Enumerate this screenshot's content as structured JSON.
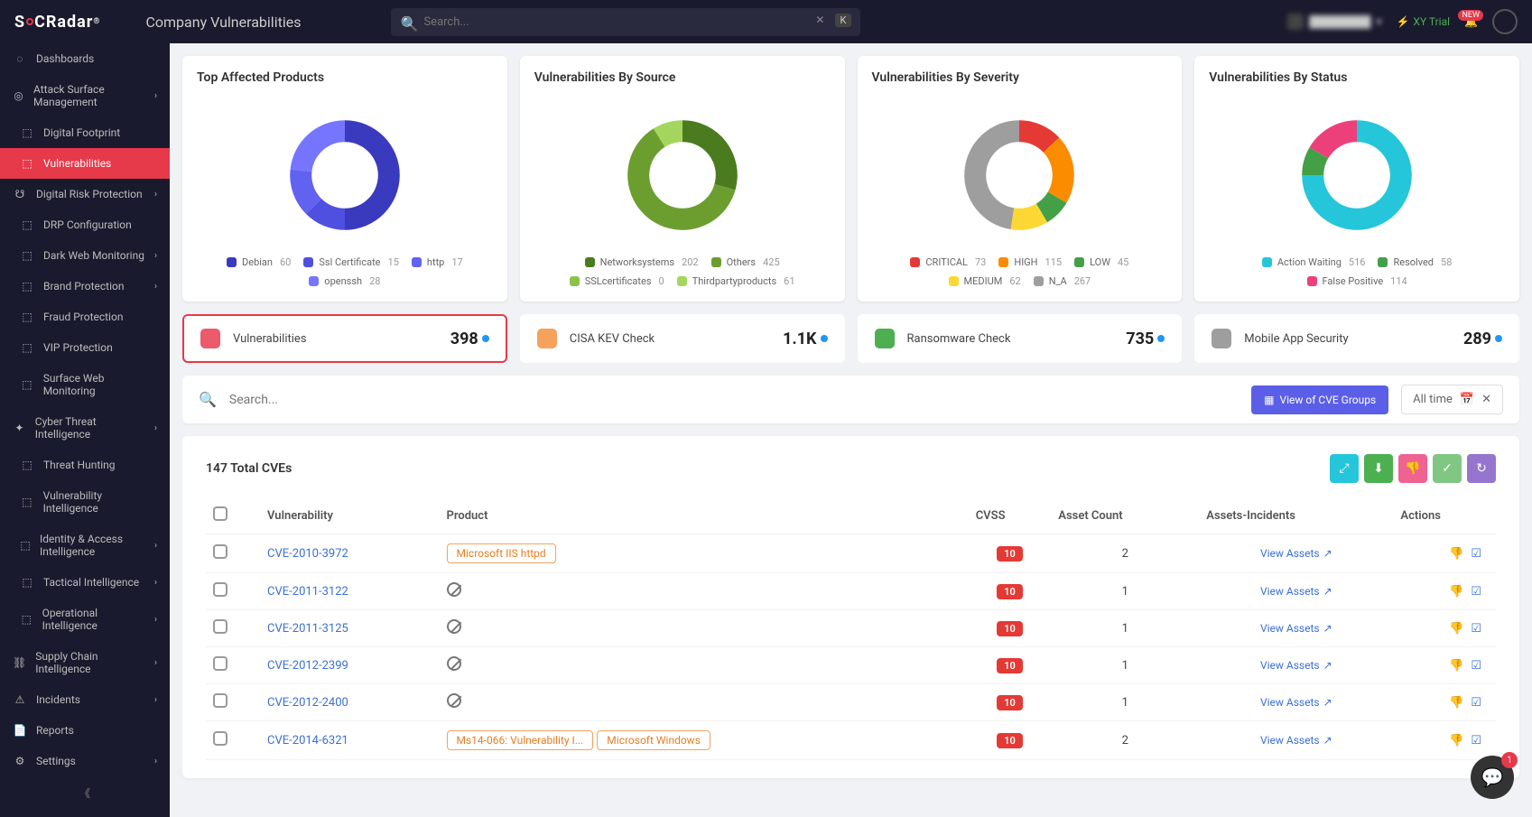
{
  "header": {
    "logo_parts": [
      "S",
      "C",
      "Radar"
    ],
    "page_title": "Company Vulnerabilities",
    "search_placeholder": "Search...",
    "kbd_key": "K",
    "trial_text": "XY Trial",
    "bell_badge_text": "NEW"
  },
  "sidebar": {
    "items": [
      {
        "icon": "◌",
        "label": "Dashboards",
        "chev": false
      },
      {
        "icon": "◎",
        "label": "Attack Surface Management",
        "chev": true
      },
      {
        "icon": "⬚",
        "label": "Digital Footprint",
        "chev": false,
        "indent": true
      },
      {
        "icon": "⬚",
        "label": "Vulnerabilities",
        "chev": false,
        "indent": true,
        "active": true
      },
      {
        "icon": "☋",
        "label": "Digital Risk Protection",
        "chev": true
      },
      {
        "icon": "⬚",
        "label": "DRP Configuration",
        "chev": false,
        "indent": true
      },
      {
        "icon": "⬚",
        "label": "Dark Web Monitoring",
        "chev": true,
        "indent": true
      },
      {
        "icon": "⬚",
        "label": "Brand Protection",
        "chev": true,
        "indent": true
      },
      {
        "icon": "⬚",
        "label": "Fraud Protection",
        "chev": false,
        "indent": true
      },
      {
        "icon": "⬚",
        "label": "VIP Protection",
        "chev": false,
        "indent": true
      },
      {
        "icon": "⬚",
        "label": "Surface Web Monitoring",
        "chev": false,
        "indent": true
      },
      {
        "icon": "✦",
        "label": "Cyber Threat Intelligence",
        "chev": true
      },
      {
        "icon": "⬚",
        "label": "Threat Hunting",
        "chev": false,
        "indent": true
      },
      {
        "icon": "⬚",
        "label": "Vulnerability Intelligence",
        "chev": false,
        "indent": true
      },
      {
        "icon": "⬚",
        "label": "Identity & Access Intelligence",
        "chev": true,
        "indent": true
      },
      {
        "icon": "⬚",
        "label": "Tactical Intelligence",
        "chev": true,
        "indent": true
      },
      {
        "icon": "⬚",
        "label": "Operational Intelligence",
        "chev": true,
        "indent": true
      },
      {
        "icon": "⛓",
        "label": "Supply Chain Intelligence",
        "chev": true
      },
      {
        "icon": "⚠",
        "label": "Incidents",
        "chev": true
      },
      {
        "icon": "📄",
        "label": "Reports",
        "chev": false
      },
      {
        "icon": "⚙",
        "label": "Settings",
        "chev": true
      }
    ]
  },
  "chart_data": [
    {
      "title": "Top Affected Products",
      "type": "pie",
      "series": [
        {
          "name": "Debian",
          "value": 60,
          "color": "#3a3abf"
        },
        {
          "name": "Ssl Certificate",
          "value": 15,
          "color": "#5050e0"
        },
        {
          "name": "http",
          "value": 17,
          "color": "#6262f0"
        },
        {
          "name": "openssh",
          "value": 28,
          "color": "#7575ff"
        }
      ]
    },
    {
      "title": "Vulnerabilities By Source",
      "type": "pie",
      "series": [
        {
          "name": "Networksystems",
          "value": 202,
          "color": "#4a7c1f"
        },
        {
          "name": "Others",
          "value": 425,
          "color": "#6b9e2f"
        },
        {
          "name": "SSLcertificates",
          "value": 0,
          "color": "#8bc34a"
        },
        {
          "name": "Thirdpartyproducts",
          "value": 61,
          "color": "#a4d65e"
        }
      ]
    },
    {
      "title": "Vulnerabilities By Severity",
      "type": "pie",
      "series": [
        {
          "name": "CRITICAL",
          "value": 73,
          "color": "#e53935"
        },
        {
          "name": "HIGH",
          "value": 115,
          "color": "#fb8c00"
        },
        {
          "name": "LOW",
          "value": 45,
          "color": "#43a047"
        },
        {
          "name": "MEDIUM",
          "value": 62,
          "color": "#fdd835"
        },
        {
          "name": "N_A",
          "value": 267,
          "color": "#9e9e9e"
        }
      ]
    },
    {
      "title": "Vulnerabilities By Status",
      "type": "pie",
      "series": [
        {
          "name": "Action Waiting",
          "value": 516,
          "color": "#26c6da"
        },
        {
          "name": "Resolved",
          "value": 58,
          "color": "#43a047"
        },
        {
          "name": "False Positive",
          "value": 114,
          "color": "#ec407a"
        }
      ]
    }
  ],
  "stats": [
    {
      "label": "Vulnerabilities",
      "value": "398",
      "color": "#ec5a6b",
      "active": true
    },
    {
      "label": "CISA KEV Check",
      "value": "1.1K",
      "color": "#f5a25d"
    },
    {
      "label": "Ransomware Check",
      "value": "735",
      "color": "#4caf50"
    },
    {
      "label": "Mobile App Security",
      "value": "289",
      "color": "#9e9e9e"
    }
  ],
  "table_search_placeholder": "Search...",
  "view_groups_label": "View of CVE Groups",
  "date_filter_label": "All time",
  "total_cves_label": "147 Total CVEs",
  "action_colors": [
    "#26c6da",
    "#4caf50",
    "#f06292",
    "#81c784",
    "#9575cd"
  ],
  "columns": [
    "",
    "Vulnerability",
    "Product",
    "CVSS",
    "Asset Count",
    "Assets-Incidents",
    "Actions"
  ],
  "rows": [
    {
      "cve": "CVE-2010-3972",
      "products": [
        "Microsoft IIS httpd"
      ],
      "cvss": "10",
      "assets": "2",
      "link": "View Assets"
    },
    {
      "cve": "CVE-2011-3122",
      "products": [],
      "cvss": "10",
      "assets": "1",
      "link": "View Assets"
    },
    {
      "cve": "CVE-2011-3125",
      "products": [],
      "cvss": "10",
      "assets": "1",
      "link": "View Assets"
    },
    {
      "cve": "CVE-2012-2399",
      "products": [],
      "cvss": "10",
      "assets": "1",
      "link": "View Assets"
    },
    {
      "cve": "CVE-2012-2400",
      "products": [],
      "cvss": "10",
      "assets": "1",
      "link": "View Assets"
    },
    {
      "cve": "CVE-2014-6321",
      "products": [
        "Ms14-066: Vulnerability I...",
        "Microsoft Windows"
      ],
      "cvss": "10",
      "assets": "2",
      "link": "View Assets"
    }
  ],
  "chat_badge": "1"
}
